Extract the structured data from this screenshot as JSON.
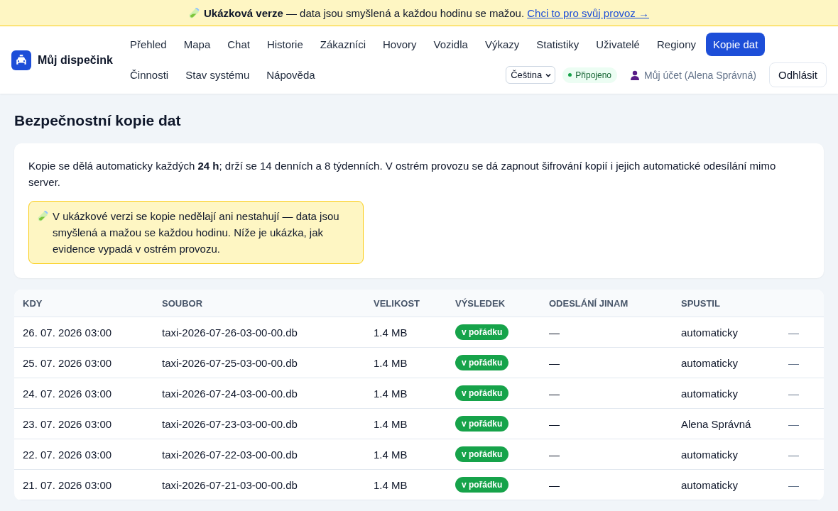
{
  "banner": {
    "title": "Ukázková verze",
    "text": " — data jsou smyšlená a každou hodinu se mažou. ",
    "link": "Chci to pro svůj provoz →"
  },
  "brand": "Můj dispečink",
  "nav": {
    "row_1": [
      {
        "label": "Přehled",
        "selected": false
      },
      {
        "label": "Mapa",
        "selected": false
      },
      {
        "label": "Chat",
        "selected": false
      },
      {
        "label": "Historie",
        "selected": false
      },
      {
        "label": "Zákazníci",
        "selected": false
      },
      {
        "label": "Hovory",
        "selected": false
      },
      {
        "label": "Vozidla",
        "selected": false
      },
      {
        "label": "Výkazy",
        "selected": false
      },
      {
        "label": "Statistiky",
        "selected": false
      },
      {
        "label": "Uživatelé",
        "selected": false
      },
      {
        "label": "Regiony",
        "selected": false
      },
      {
        "label": "Kopie dat",
        "selected": true
      }
    ],
    "row_2": [
      {
        "label": "Činnosti",
        "selected": false
      },
      {
        "label": "Stav systému",
        "selected": false
      },
      {
        "label": "Nápověda",
        "selected": false
      }
    ]
  },
  "language": {
    "value": "Čeština"
  },
  "connection": {
    "label": "Připojeno"
  },
  "account": "Můj účet (Alena Správná)",
  "logout": "Odhlásit",
  "page_title": "Bezpečnostní kopie dat",
  "info": "Kopie se dělá automaticky každých **24 h**; drží se 14 denních a 8 týdenních. V ostrém provozu se dá zapnout šifrování kopií i jejich automatické odesílání mimo server.",
  "notice": "V ukázkové verzi se kopie nedělají ani nestahují — data jsou smyšlená a mažou se každou hodinu. Níže je ukázka, jak evidence vypadá v ostrém provozu.",
  "table": {
    "columns": [
      "KDY",
      "SOUBOR",
      "VELIKOST",
      "VÝSLEDEK",
      "ODESLÁNÍ JINAM",
      "SPUSTIL"
    ],
    "rows": [
      {
        "kdy": "26. 07. 2026 03:00",
        "soubor": "taxi-2026-07-26-03-00-00.db",
        "velikost": "1.4 MB",
        "vysledek": "v pořádku",
        "odeslani": "—",
        "spustil": "automaticky",
        "column_7": "—"
      },
      {
        "kdy": "25. 07. 2026 03:00",
        "soubor": "taxi-2026-07-25-03-00-00.db",
        "velikost": "1.4 MB",
        "vysledek": "v pořádku",
        "odeslani": "—",
        "spustil": "automaticky",
        "column_7": "—"
      },
      {
        "kdy": "24. 07. 2026 03:00",
        "soubor": "taxi-2026-07-24-03-00-00.db",
        "velikost": "1.4 MB",
        "vysledek": "v pořádku",
        "odeslani": "—",
        "spustil": "automaticky",
        "column_7": "—"
      },
      {
        "kdy": "23. 07. 2026 03:00",
        "soubor": "taxi-2026-07-23-03-00-00.db",
        "velikost": "1.4 MB",
        "vysledek": "v pořádku",
        "odeslani": "—",
        "spustil": "Alena Správná",
        "column_7": "—"
      },
      {
        "kdy": "22. 07. 2026 03:00",
        "soubor": "taxi-2026-07-22-03-00-00.db",
        "velikost": "1.4 MB",
        "vysledek": "v pořádku",
        "odeslani": "—",
        "spustil": "automaticky",
        "column_7": "—"
      },
      {
        "kdy": "21. 07. 2026 03:00",
        "soubor": "taxi-2026-07-21-03-00-00.db",
        "velikost": "1.4 MB",
        "vysledek": "v pořádku",
        "odeslani": "—",
        "spustil": "automaticky",
        "column_7": "—"
      }
    ]
  }
}
